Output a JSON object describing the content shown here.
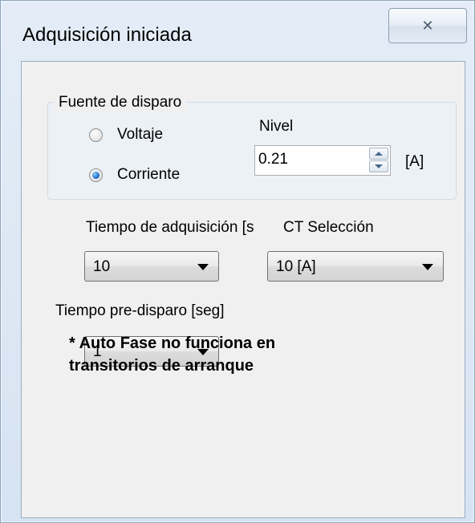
{
  "window": {
    "title": "Adquisición iniciada",
    "close_label": "✕"
  },
  "trigger_source": {
    "legend": "Fuente de disparo",
    "options": [
      {
        "label": "Voltaje",
        "selected": false
      },
      {
        "label": "Corriente",
        "selected": true
      }
    ]
  },
  "level": {
    "label": "Nivel",
    "value": "0.21",
    "unit": "[A]"
  },
  "acquisition_time": {
    "label": "Tiempo de adquisición [s",
    "value": "10"
  },
  "ct_selection": {
    "label": "CT Selección",
    "value": "10 [A]"
  },
  "pretrigger_time": {
    "label": "Tiempo pre-disparo [seg]",
    "value": "1"
  },
  "note": {
    "line1": "* Auto Fase no funciona en",
    "line2": "transitorios de arranque"
  }
}
